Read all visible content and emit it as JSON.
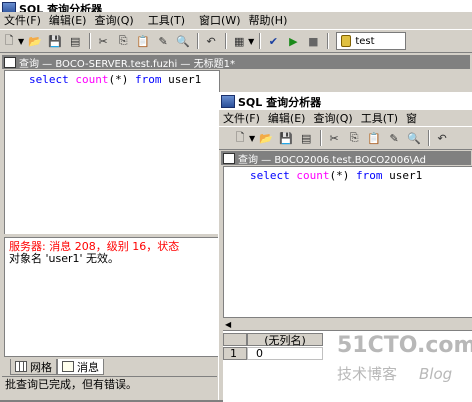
{
  "back_window": {
    "title": "SQL 查询分析器",
    "menu": [
      "文件(F)",
      "编辑(E)",
      "查询(Q)",
      "工具(T)",
      "窗口(W)",
      "帮助(H)"
    ],
    "database": "test",
    "query_window_title": "查询 — BOCO-SERVER.test.fuzhi — 无标题1*",
    "query_text": {
      "kw1": "select",
      "fn": "count",
      "args": "(*)",
      "kw2": "from",
      "table": "user1"
    },
    "error_line": "服务器: 消息 208，级别 16，状态",
    "error_detail": "对象名 'user1' 无效。",
    "tabs": [
      "网格",
      "消息"
    ],
    "status": "批查询已完成，但有错误。"
  },
  "front_window": {
    "title": "SQL 查询分析器",
    "menu": [
      "文件(F)",
      "编辑(E)",
      "查询(Q)",
      "工具(T)",
      "窗"
    ],
    "query_window_title": "查询 — BOCO2006.test.BOCO2006\\Ad",
    "query_text": {
      "kw1": "select",
      "fn": "count",
      "args": "(*)",
      "kw2": "from",
      "table": "user1"
    },
    "grid": {
      "header": "(无列名)",
      "row_number": "1",
      "value": "0"
    }
  },
  "watermark": {
    "line1": "51CTO.com",
    "line2": "技术博客",
    "line3": "Blog"
  }
}
